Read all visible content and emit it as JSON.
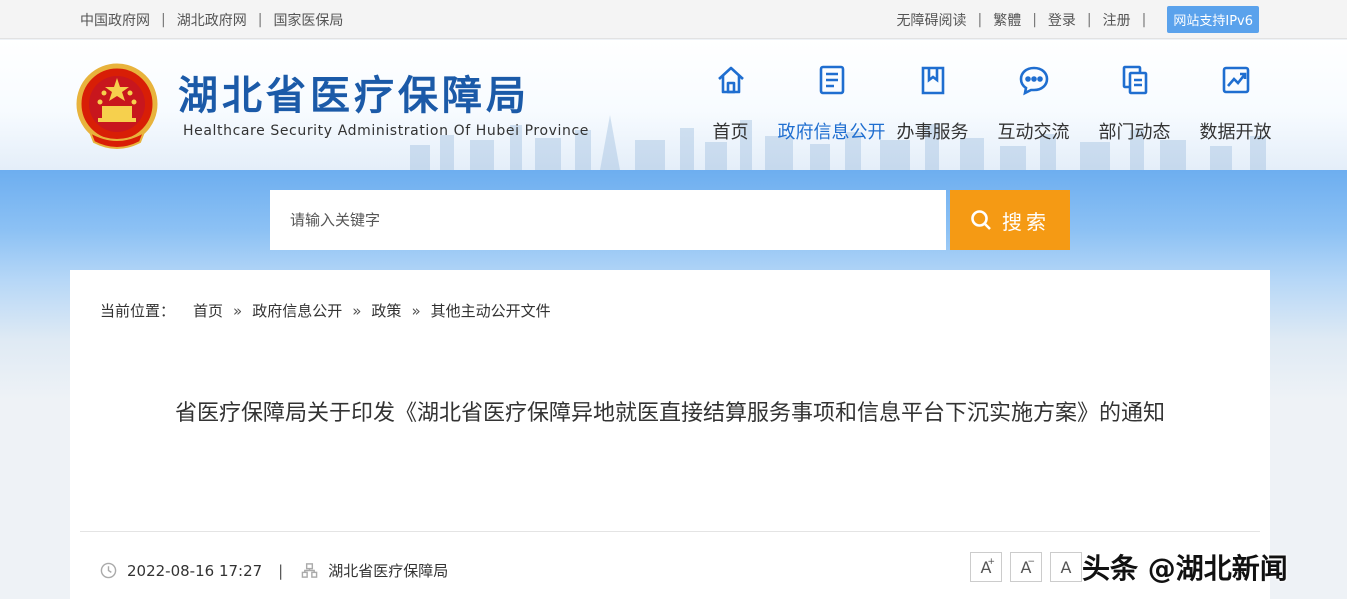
{
  "topbar": {
    "links": [
      "中国政府网",
      "湖北政府网",
      "国家医保局"
    ],
    "right_links": [
      "无障碍阅读",
      "繁體",
      "登录",
      "注册"
    ],
    "ipv6_badge": "网站支持IPv6"
  },
  "header": {
    "title": "湖北省医疗保障局",
    "subtitle": "Healthcare Security Administration Of Hubei Province",
    "nav": [
      {
        "label": "首页",
        "icon": "home-icon"
      },
      {
        "label": "政府信息公开",
        "icon": "document-list-icon",
        "active": true
      },
      {
        "label": "办事服务",
        "icon": "bookmark-book-icon"
      },
      {
        "label": "互动交流",
        "icon": "chat-bubble-icon"
      },
      {
        "label": "部门动态",
        "icon": "copy-documents-icon"
      },
      {
        "label": "数据开放",
        "icon": "line-chart-icon"
      }
    ]
  },
  "search": {
    "placeholder": "请输入关键字",
    "button_label": "搜索"
  },
  "breadcrumb": {
    "lead": "当前位置：",
    "items": [
      "首页",
      "政府信息公开",
      "政策",
      "其他主动公开文件"
    ],
    "separator": "»"
  },
  "article": {
    "title": "省医疗保障局关于印发《湖北省医疗保障异地就医直接结算服务事项和信息平台下沉实施方案》的通知",
    "date": "2022-08-16 17:27",
    "meta_separator": "|",
    "source": "湖北省医疗保障局"
  },
  "font_controls": [
    "A",
    "A",
    "A"
  ],
  "watermark": "头条 @湖北新闻",
  "colors": {
    "brand_blue": "#1b5aa8",
    "nav_active": "#1f6ed0",
    "search_button": "#f59a14",
    "ipv6_badge": "#5aa2ec"
  }
}
